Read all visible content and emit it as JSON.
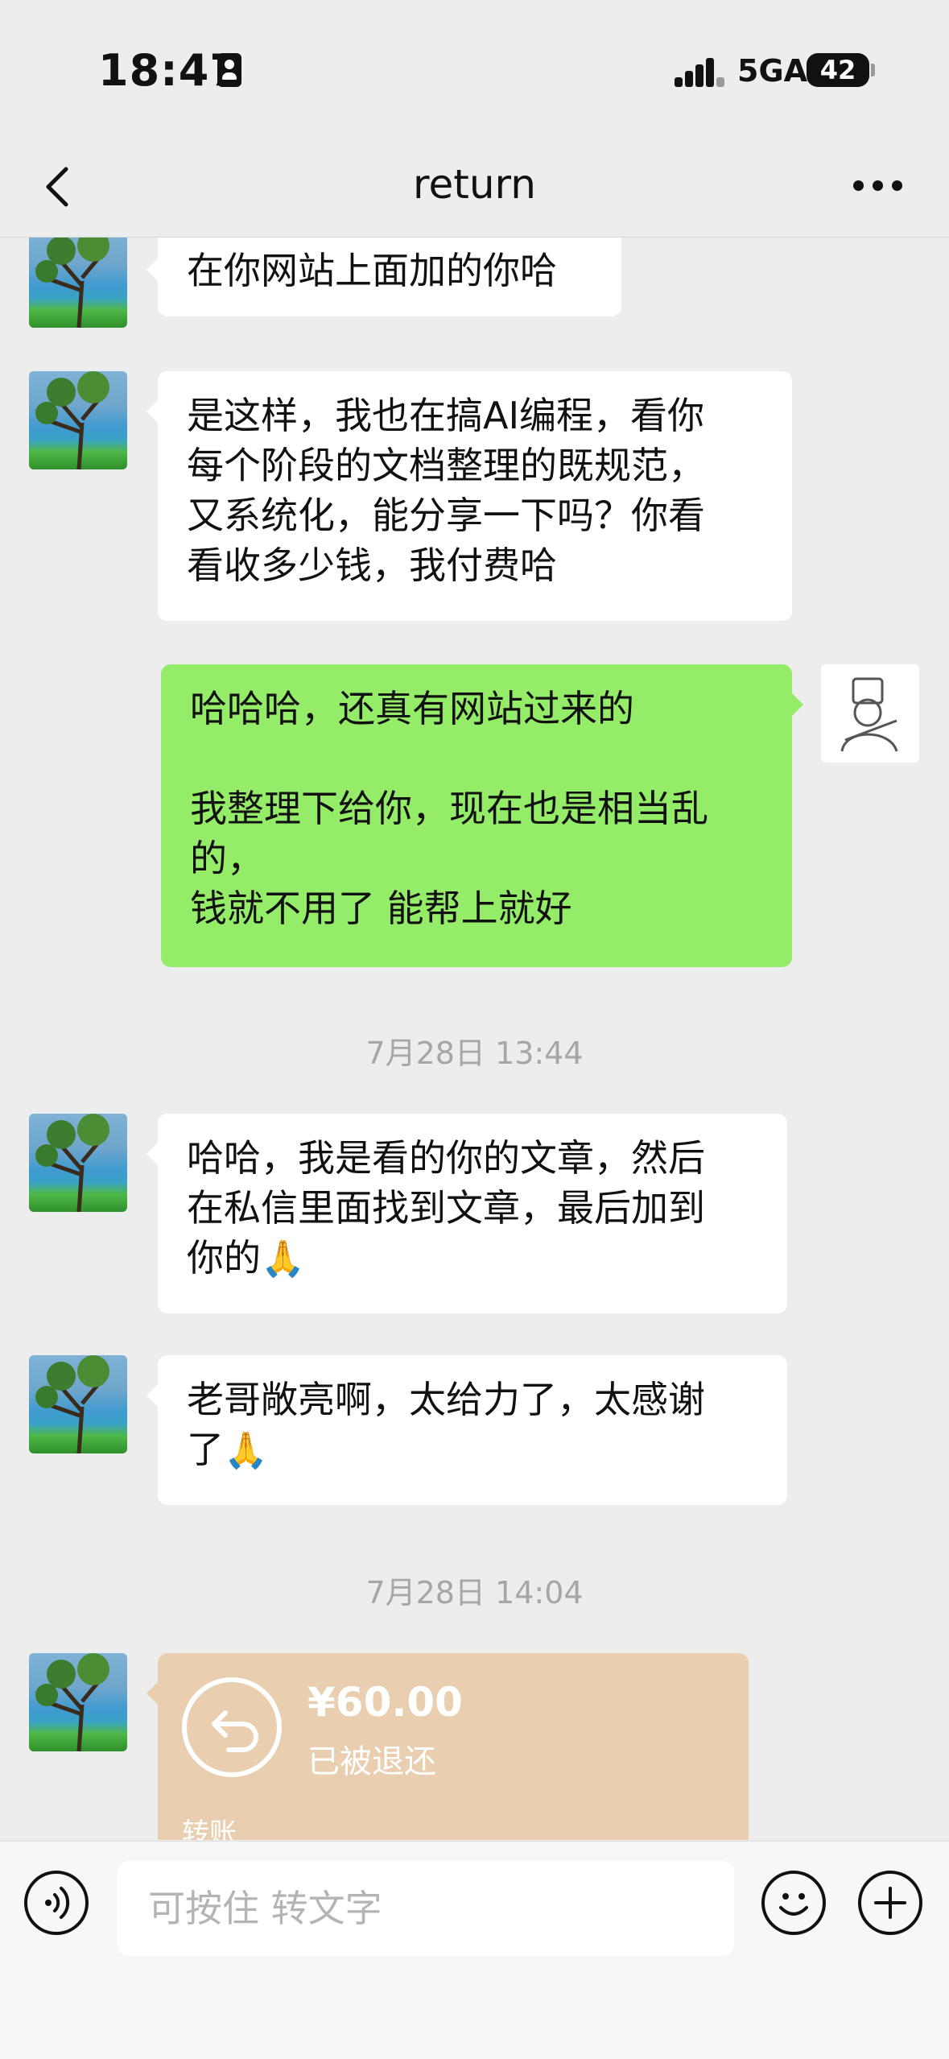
{
  "status_bar": {
    "time": "18:47",
    "network": "5GA",
    "battery": "42"
  },
  "nav": {
    "title": "return"
  },
  "messages": [
    {
      "side": "left",
      "text": "在你网站上面加的你哈"
    },
    {
      "side": "left",
      "text": "是这样，我也在搞AI编程，看你\n每个阶段的文档整理的既规范，\n又系统化，能分享一下吗？你看\n看收多少钱，我付费哈"
    },
    {
      "side": "right",
      "text": "哈哈哈，还真有网站过来的\n\n我整理下给你，现在也是相当乱\n的，\n钱就不用了 能帮上就好"
    },
    {
      "type": "timestamp",
      "text": "7月28日 13:44"
    },
    {
      "side": "left",
      "text": "哈哈，我是看的你的文章，然后\n在私信里面找到文章，最后加到\n你的",
      "emoji": "folded-hands"
    },
    {
      "side": "left",
      "text": "老哥敞亮啊，太给力了，太感谢\n了",
      "emoji": "folded-hands"
    },
    {
      "type": "timestamp",
      "text": "7月28日 14:04"
    },
    {
      "side": "left",
      "type": "transfer",
      "amount": "¥60.00",
      "status": "已被退还",
      "label": "转账"
    }
  ],
  "input": {
    "placeholder": "可按住 转文字"
  },
  "icons": {
    "back": "chevron-left-icon",
    "more": "more-icon",
    "voice": "voice-icon",
    "emoji": "emoji-icon",
    "plus": "plus-icon",
    "transfer": "return-arrow-icon"
  },
  "colors": {
    "background": "#ededed",
    "bubble_right": "#95ec69",
    "transfer_card": "#e9cfb0"
  }
}
